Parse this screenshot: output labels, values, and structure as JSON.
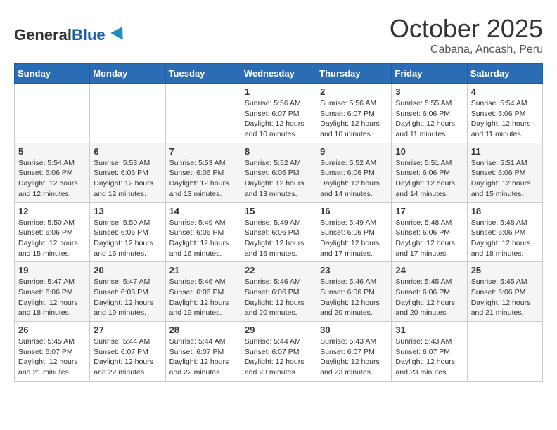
{
  "logo": {
    "general": "General",
    "blue": "Blue"
  },
  "header": {
    "month": "October 2025",
    "location": "Cabana, Ancash, Peru"
  },
  "weekdays": [
    "Sunday",
    "Monday",
    "Tuesday",
    "Wednesday",
    "Thursday",
    "Friday",
    "Saturday"
  ],
  "weeks": [
    [
      {
        "day": "",
        "sunrise": "",
        "sunset": "",
        "daylight": ""
      },
      {
        "day": "",
        "sunrise": "",
        "sunset": "",
        "daylight": ""
      },
      {
        "day": "",
        "sunrise": "",
        "sunset": "",
        "daylight": ""
      },
      {
        "day": "1",
        "sunrise": "Sunrise: 5:56 AM",
        "sunset": "Sunset: 6:07 PM",
        "daylight": "Daylight: 12 hours and 10 minutes."
      },
      {
        "day": "2",
        "sunrise": "Sunrise: 5:56 AM",
        "sunset": "Sunset: 6:07 PM",
        "daylight": "Daylight: 12 hours and 10 minutes."
      },
      {
        "day": "3",
        "sunrise": "Sunrise: 5:55 AM",
        "sunset": "Sunset: 6:06 PM",
        "daylight": "Daylight: 12 hours and 11 minutes."
      },
      {
        "day": "4",
        "sunrise": "Sunrise: 5:54 AM",
        "sunset": "Sunset: 6:06 PM",
        "daylight": "Daylight: 12 hours and 11 minutes."
      }
    ],
    [
      {
        "day": "5",
        "sunrise": "Sunrise: 5:54 AM",
        "sunset": "Sunset: 6:06 PM",
        "daylight": "Daylight: 12 hours and 12 minutes."
      },
      {
        "day": "6",
        "sunrise": "Sunrise: 5:53 AM",
        "sunset": "Sunset: 6:06 PM",
        "daylight": "Daylight: 12 hours and 12 minutes."
      },
      {
        "day": "7",
        "sunrise": "Sunrise: 5:53 AM",
        "sunset": "Sunset: 6:06 PM",
        "daylight": "Daylight: 12 hours and 13 minutes."
      },
      {
        "day": "8",
        "sunrise": "Sunrise: 5:52 AM",
        "sunset": "Sunset: 6:06 PM",
        "daylight": "Daylight: 12 hours and 13 minutes."
      },
      {
        "day": "9",
        "sunrise": "Sunrise: 5:52 AM",
        "sunset": "Sunset: 6:06 PM",
        "daylight": "Daylight: 12 hours and 14 minutes."
      },
      {
        "day": "10",
        "sunrise": "Sunrise: 5:51 AM",
        "sunset": "Sunset: 6:06 PM",
        "daylight": "Daylight: 12 hours and 14 minutes."
      },
      {
        "day": "11",
        "sunrise": "Sunrise: 5:51 AM",
        "sunset": "Sunset: 6:06 PM",
        "daylight": "Daylight: 12 hours and 15 minutes."
      }
    ],
    [
      {
        "day": "12",
        "sunrise": "Sunrise: 5:50 AM",
        "sunset": "Sunset: 6:06 PM",
        "daylight": "Daylight: 12 hours and 15 minutes."
      },
      {
        "day": "13",
        "sunrise": "Sunrise: 5:50 AM",
        "sunset": "Sunset: 6:06 PM",
        "daylight": "Daylight: 12 hours and 16 minutes."
      },
      {
        "day": "14",
        "sunrise": "Sunrise: 5:49 AM",
        "sunset": "Sunset: 6:06 PM",
        "daylight": "Daylight: 12 hours and 16 minutes."
      },
      {
        "day": "15",
        "sunrise": "Sunrise: 5:49 AM",
        "sunset": "Sunset: 6:06 PM",
        "daylight": "Daylight: 12 hours and 16 minutes."
      },
      {
        "day": "16",
        "sunrise": "Sunrise: 5:49 AM",
        "sunset": "Sunset: 6:06 PM",
        "daylight": "Daylight: 12 hours and 17 minutes."
      },
      {
        "day": "17",
        "sunrise": "Sunrise: 5:48 AM",
        "sunset": "Sunset: 6:06 PM",
        "daylight": "Daylight: 12 hours and 17 minutes."
      },
      {
        "day": "18",
        "sunrise": "Sunrise: 5:48 AM",
        "sunset": "Sunset: 6:06 PM",
        "daylight": "Daylight: 12 hours and 18 minutes."
      }
    ],
    [
      {
        "day": "19",
        "sunrise": "Sunrise: 5:47 AM",
        "sunset": "Sunset: 6:06 PM",
        "daylight": "Daylight: 12 hours and 18 minutes."
      },
      {
        "day": "20",
        "sunrise": "Sunrise: 5:47 AM",
        "sunset": "Sunset: 6:06 PM",
        "daylight": "Daylight: 12 hours and 19 minutes."
      },
      {
        "day": "21",
        "sunrise": "Sunrise: 5:46 AM",
        "sunset": "Sunset: 6:06 PM",
        "daylight": "Daylight: 12 hours and 19 minutes."
      },
      {
        "day": "22",
        "sunrise": "Sunrise: 5:46 AM",
        "sunset": "Sunset: 6:06 PM",
        "daylight": "Daylight: 12 hours and 20 minutes."
      },
      {
        "day": "23",
        "sunrise": "Sunrise: 5:46 AM",
        "sunset": "Sunset: 6:06 PM",
        "daylight": "Daylight: 12 hours and 20 minutes."
      },
      {
        "day": "24",
        "sunrise": "Sunrise: 5:45 AM",
        "sunset": "Sunset: 6:06 PM",
        "daylight": "Daylight: 12 hours and 20 minutes."
      },
      {
        "day": "25",
        "sunrise": "Sunrise: 5:45 AM",
        "sunset": "Sunset: 6:06 PM",
        "daylight": "Daylight: 12 hours and 21 minutes."
      }
    ],
    [
      {
        "day": "26",
        "sunrise": "Sunrise: 5:45 AM",
        "sunset": "Sunset: 6:07 PM",
        "daylight": "Daylight: 12 hours and 21 minutes."
      },
      {
        "day": "27",
        "sunrise": "Sunrise: 5:44 AM",
        "sunset": "Sunset: 6:07 PM",
        "daylight": "Daylight: 12 hours and 22 minutes."
      },
      {
        "day": "28",
        "sunrise": "Sunrise: 5:44 AM",
        "sunset": "Sunset: 6:07 PM",
        "daylight": "Daylight: 12 hours and 22 minutes."
      },
      {
        "day": "29",
        "sunrise": "Sunrise: 5:44 AM",
        "sunset": "Sunset: 6:07 PM",
        "daylight": "Daylight: 12 hours and 23 minutes."
      },
      {
        "day": "30",
        "sunrise": "Sunrise: 5:43 AM",
        "sunset": "Sunset: 6:07 PM",
        "daylight": "Daylight: 12 hours and 23 minutes."
      },
      {
        "day": "31",
        "sunrise": "Sunrise: 5:43 AM",
        "sunset": "Sunset: 6:07 PM",
        "daylight": "Daylight: 12 hours and 23 minutes."
      },
      {
        "day": "",
        "sunrise": "",
        "sunset": "",
        "daylight": ""
      }
    ]
  ]
}
